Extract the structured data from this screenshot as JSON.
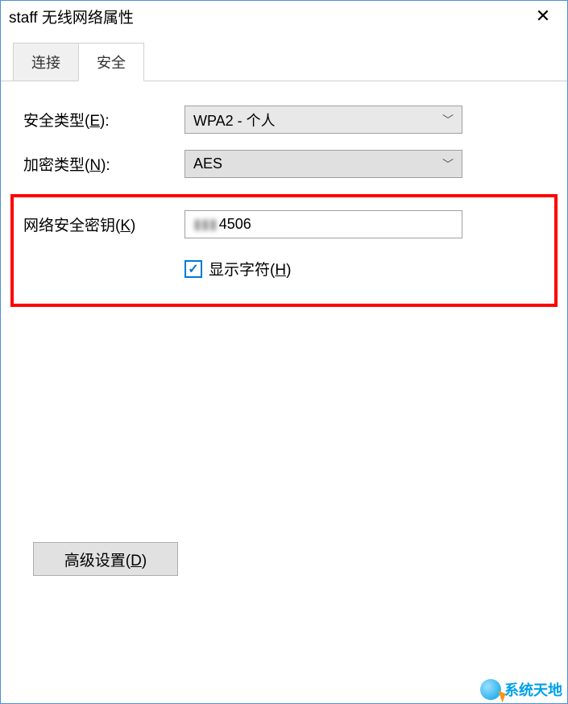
{
  "window": {
    "title": "staff 无线网络属性",
    "close_symbol": "✕"
  },
  "tabs": {
    "connection": "连接",
    "security": "安全"
  },
  "fields": {
    "security_type_label": "安全类型(E):",
    "security_type_value": "WPA2 - 个人",
    "encryption_label": "加密类型(N):",
    "encryption_value": "AES",
    "key_label": "网络安全密钥(K)",
    "key_masked_prefix": "▮▮▮",
    "key_visible_suffix": "4506",
    "show_chars_label": "显示字符(H)",
    "checkbox_checked_glyph": "✓"
  },
  "buttons": {
    "advanced": "高级设置(D)"
  },
  "watermark": "系统天地"
}
